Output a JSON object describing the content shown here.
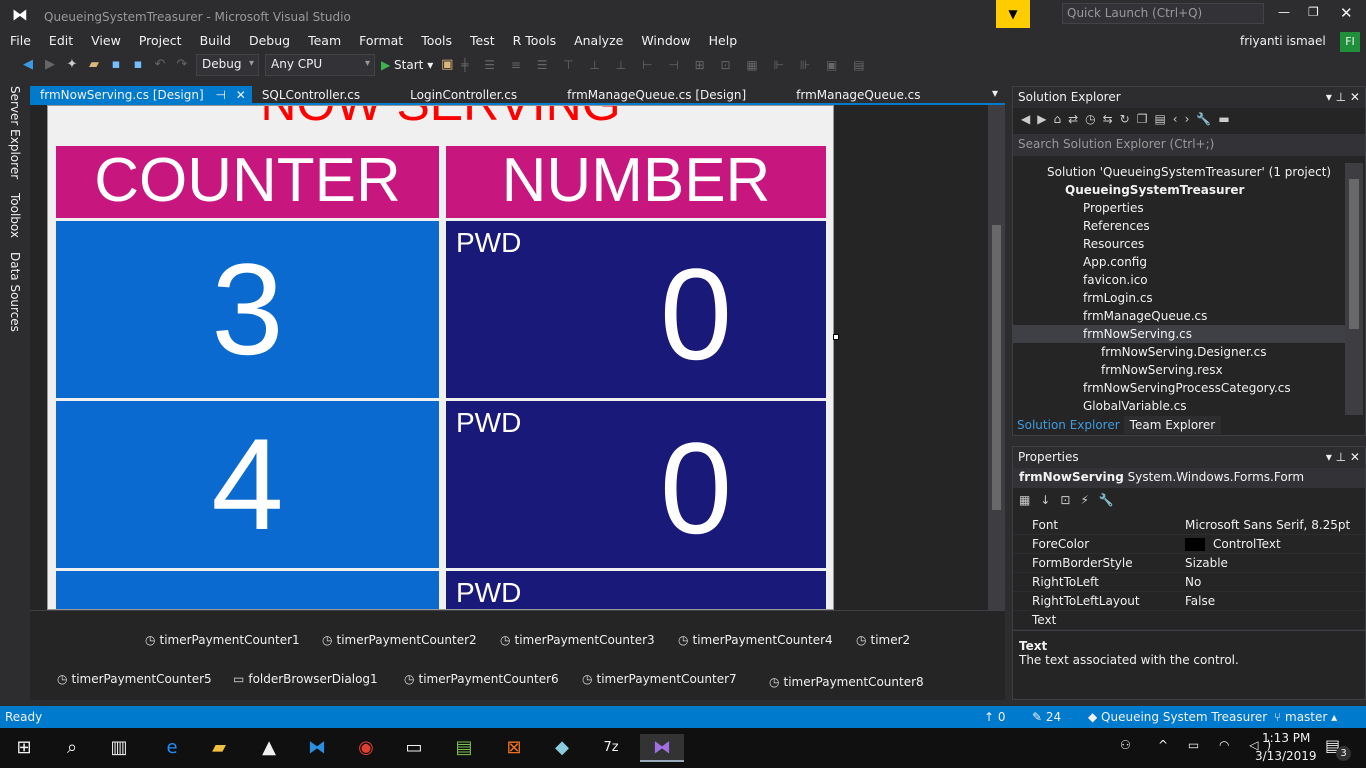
{
  "window": {
    "title": "QueueingSystemTreasurer - Microsoft Visual Studio",
    "quick_launch": "Quick Launch (Ctrl+Q)",
    "user": "friyanti ismael",
    "user_initials": "FI"
  },
  "menu": [
    "File",
    "Edit",
    "View",
    "Project",
    "Build",
    "Debug",
    "Team",
    "Format",
    "Tools",
    "Test",
    "R Tools",
    "Analyze",
    "Window",
    "Help"
  ],
  "toolbar": {
    "config": "Debug",
    "platform": "Any CPU",
    "start": "Start"
  },
  "tabs": [
    "frmNowServing.cs [Design]",
    "SQLController.cs",
    "LoginController.cs",
    "frmManageQueue.cs [Design]",
    "frmManageQueue.cs"
  ],
  "left_strip": [
    "Server Explorer",
    "Toolbox",
    "Data Sources"
  ],
  "form": {
    "title": "NOW SERVING",
    "header_counter": "COUNTER",
    "header_number": "NUMBER",
    "rows": [
      {
        "counter": "3",
        "category": "PWD",
        "number": "0"
      },
      {
        "counter": "4",
        "category": "PWD",
        "number": "0"
      },
      {
        "counter": "",
        "category": "PWD",
        "number": ""
      }
    ]
  },
  "tray": [
    "timerPaymentCounter1",
    "timerPaymentCounter2",
    "timerPaymentCounter3",
    "timerPaymentCounter4",
    "timer2",
    "timerPaymentCounter5",
    "folderBrowserDialog1",
    "timerPaymentCounter6",
    "timerPaymentCounter7",
    "timerPaymentCounter8"
  ],
  "solution_explorer": {
    "title": "Solution Explorer",
    "search_placeholder": "Search Solution Explorer (Ctrl+;)",
    "items": [
      "Solution 'QueueingSystemTreasurer' (1 project)",
      "QueueingSystemTreasurer",
      "Properties",
      "References",
      "Resources",
      "App.config",
      "favicon.ico",
      "frmLogin.cs",
      "frmManageQueue.cs",
      "frmNowServing.cs",
      "frmNowServing.Designer.cs",
      "frmNowServing.resx",
      "frmNowServingProcessCategory.cs",
      "GlobalVariable.cs"
    ],
    "bottom_tabs": [
      "Solution Explorer",
      "Team Explorer"
    ]
  },
  "properties": {
    "title": "Properties",
    "object": "frmNowServing",
    "type": "System.Windows.Forms.Form",
    "rows": [
      {
        "k": "Font",
        "v": "Microsoft Sans Serif, 8.25pt"
      },
      {
        "k": "ForeColor",
        "v": "ControlText"
      },
      {
        "k": "FormBorderStyle",
        "v": "Sizable"
      },
      {
        "k": "RightToLeft",
        "v": "No"
      },
      {
        "k": "RightToLeftLayout",
        "v": "False"
      },
      {
        "k": "Text",
        "v": ""
      }
    ],
    "desc_title": "Text",
    "desc": "The text associated with the control."
  },
  "status": {
    "left": "Ready",
    "up": "0",
    "edits": "24",
    "repo": "Queueing System Treasurer",
    "branch": "master"
  },
  "taskbar": {
    "time": "1:13 PM",
    "date": "3/13/2019",
    "notifications": "3"
  }
}
